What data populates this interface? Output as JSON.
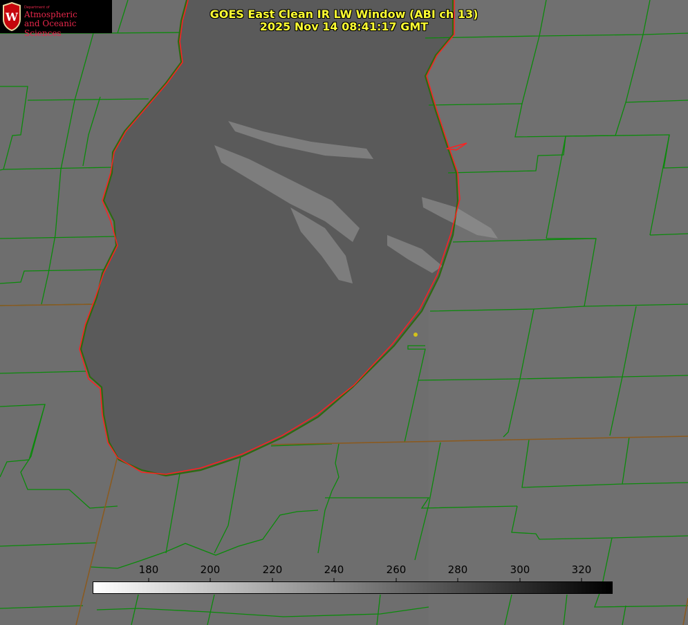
{
  "title": {
    "line1": "GOES East Clean IR LW Window (ABI ch 13)",
    "line2": "2025 Nov 14 08:41:17 GMT"
  },
  "logo": {
    "department": "Department of",
    "line1": "Atmospheric",
    "line2": "and Oceanic Sciences",
    "crest_letter": "W"
  },
  "colorbar": {
    "ticks": [
      "180",
      "200",
      "220",
      "240",
      "260",
      "280",
      "300",
      "320"
    ],
    "min": 162,
    "max": 330,
    "scale_from": "white",
    "scale_to": "black"
  },
  "colors": {
    "county_lines": "#0a8a0a",
    "coastline": "#ff2020",
    "title_text": "#ffff33",
    "marker": "#d4c21a",
    "land": "#6f6f6f",
    "lake": "#5c5c5c",
    "clouds": "#9a9a9a"
  }
}
